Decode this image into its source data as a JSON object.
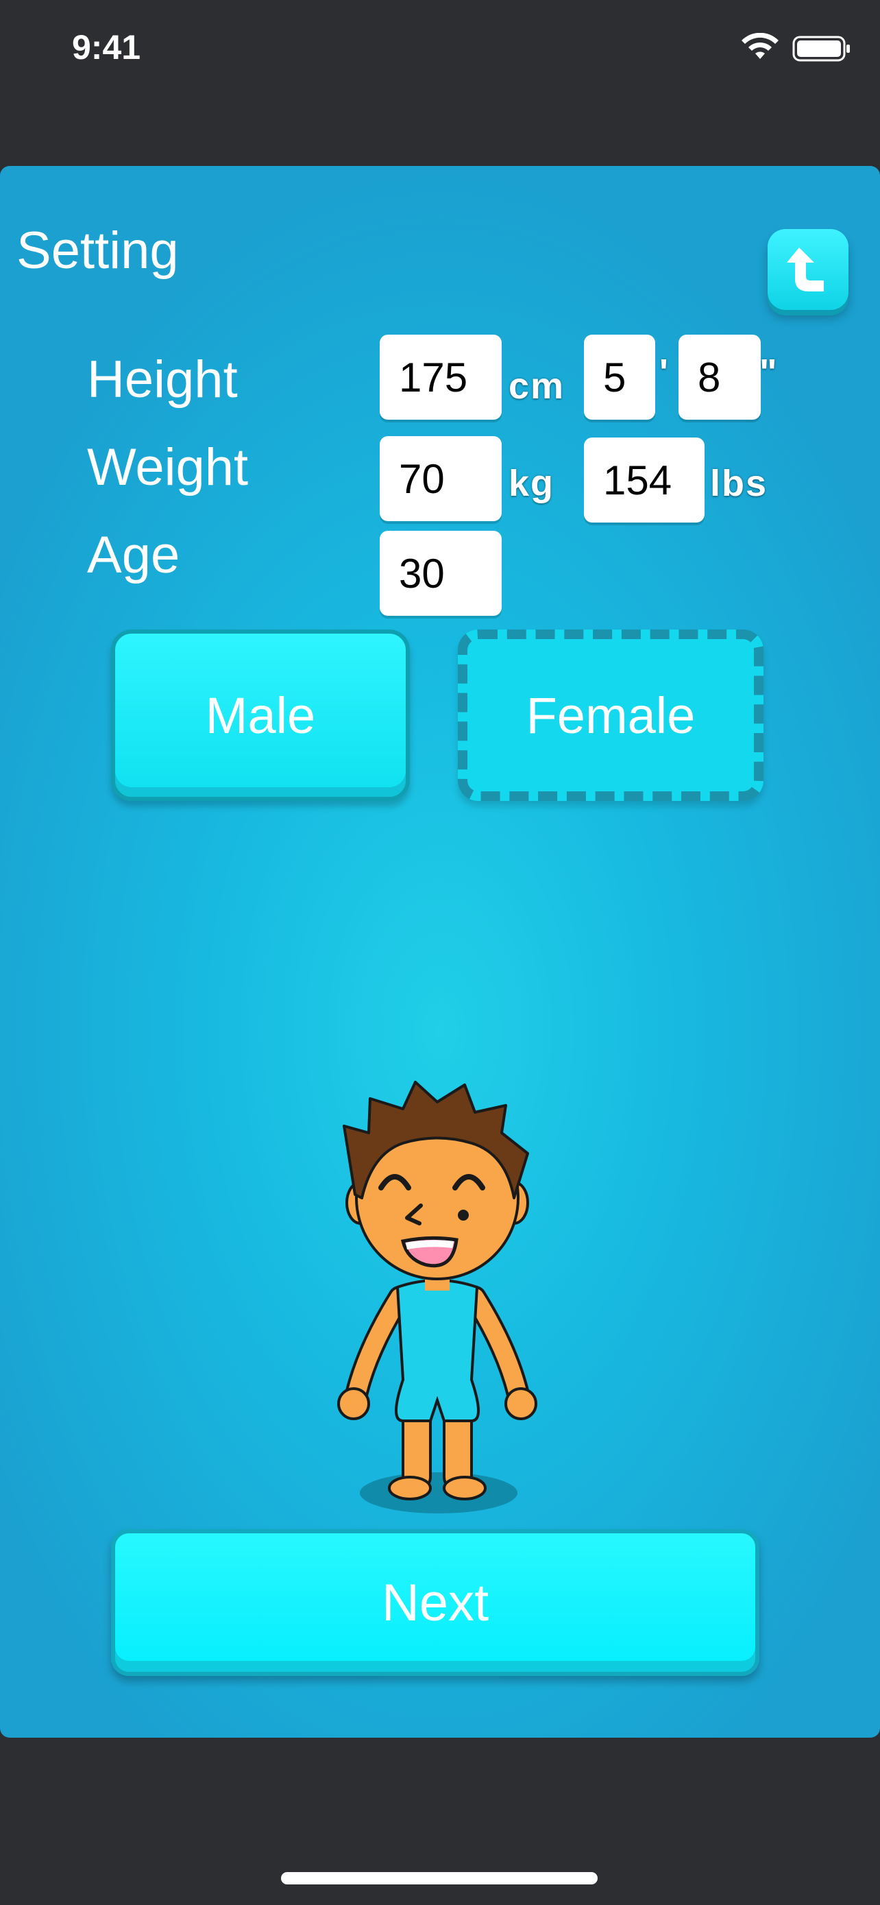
{
  "status_bar": {
    "time": "9:41"
  },
  "header": {
    "title": "Setting"
  },
  "form": {
    "height": {
      "label": "Height",
      "cm_value": "175",
      "cm_unit": "cm",
      "feet_value": "5",
      "feet_unit": "'",
      "inches_value": "8",
      "inches_unit": "\""
    },
    "weight": {
      "label": "Weight",
      "kg_value": "70",
      "kg_unit": "kg",
      "lbs_value": "154",
      "lbs_unit": "lbs"
    },
    "age": {
      "label": "Age",
      "value": "30"
    }
  },
  "gender": {
    "male_label": "Male",
    "female_label": "Female",
    "selected": "Male"
  },
  "footer": {
    "next_label": "Next"
  },
  "colors": {
    "accent": "#0fe0f0",
    "panel": "#1ba8d8",
    "background": "#2d2e31"
  },
  "icons": [
    "wifi-icon",
    "battery-icon",
    "return-arrow-icon"
  ]
}
